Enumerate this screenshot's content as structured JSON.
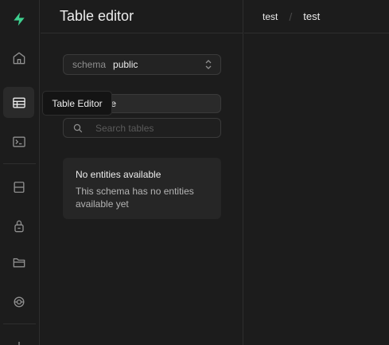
{
  "sidebar": {
    "items": [
      {
        "icon": "supabase-logo-icon"
      },
      {
        "icon": "home-icon"
      },
      {
        "icon": "table-icon",
        "active": true
      },
      {
        "icon": "terminal-icon"
      },
      {
        "icon": "database-icon"
      },
      {
        "icon": "lock-icon"
      },
      {
        "icon": "folder-icon"
      },
      {
        "icon": "edge-function-icon"
      },
      {
        "icon": "plus-icon"
      }
    ],
    "tooltip": "Table Editor"
  },
  "panel": {
    "title": "Table editor",
    "schema_label": "schema",
    "schema_value": "public",
    "new_table_label": "table",
    "search_placeholder": "Search tables",
    "empty_title": "No entities available",
    "empty_description": "This schema has no entities available yet"
  },
  "breadcrumb": {
    "org": "test",
    "separator": "/",
    "project": "test"
  },
  "colors": {
    "brand": "#3ecf8e",
    "background": "#1c1c1c",
    "border": "#2e2e2e"
  }
}
